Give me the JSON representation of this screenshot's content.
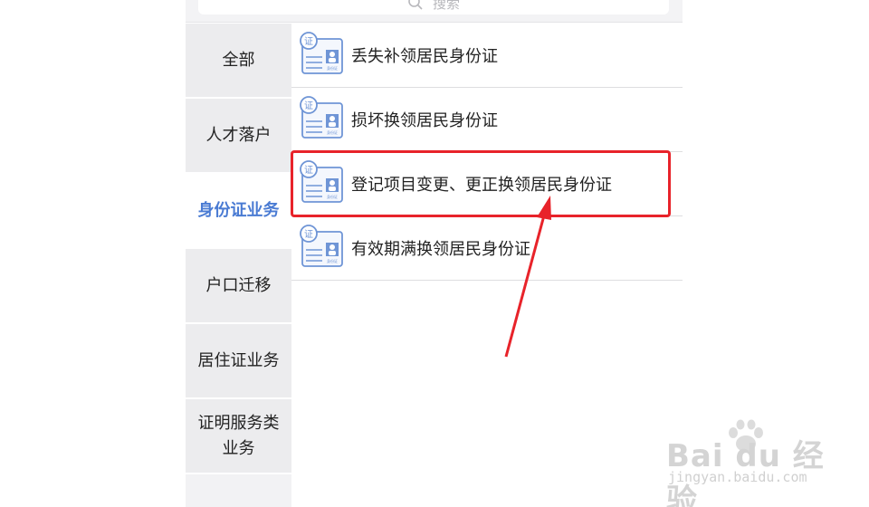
{
  "search": {
    "placeholder": "搜索"
  },
  "sidebar": {
    "items": [
      {
        "label": "全部",
        "active": false
      },
      {
        "label": "人才落户",
        "active": false
      },
      {
        "label": "身份证业务",
        "active": true
      },
      {
        "label": "户口迁移",
        "active": false
      },
      {
        "label": "居住证业务",
        "active": false
      },
      {
        "label": "证明服务类业务",
        "active": false
      }
    ]
  },
  "services": [
    {
      "label": "丢失补领居民身份证",
      "icon": "id-card-icon"
    },
    {
      "label": "损坏换领居民身份证",
      "icon": "id-card-icon"
    },
    {
      "label": "登记项目变更、更正换领居民身份证",
      "icon": "id-card-icon",
      "highlighted": true
    },
    {
      "label": "有效期满换领居民身份证",
      "icon": "id-card-icon"
    }
  ],
  "icon_text": {
    "badge": "证",
    "card_caption": "身份证"
  },
  "watermark": {
    "brand": "Bai du 经验",
    "url": "jingyan.baidu.com"
  },
  "colors": {
    "accent": "#4a7bd3",
    "annotation": "#e8232a",
    "sidebar_bg": "#ececee"
  }
}
